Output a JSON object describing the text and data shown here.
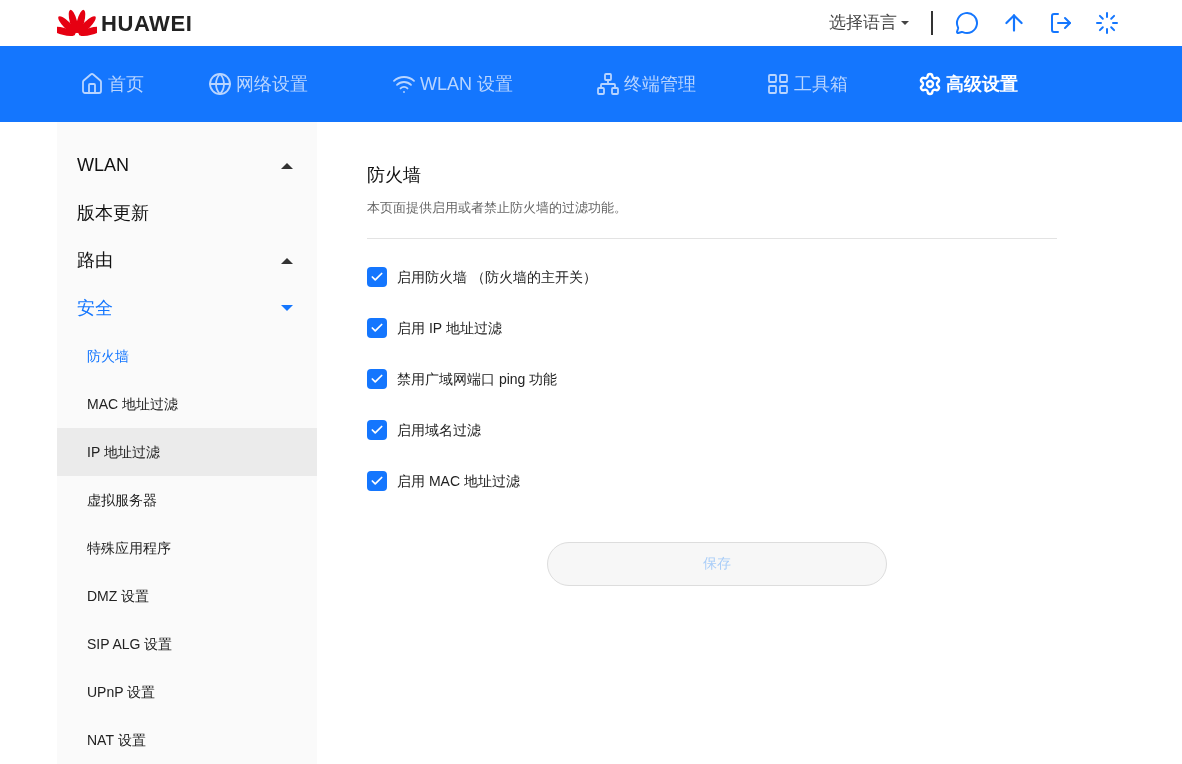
{
  "header": {
    "brand": "HUAWEI",
    "language": "选择语言"
  },
  "nav": [
    {
      "label": "首页",
      "selected": false
    },
    {
      "label": "网络设置",
      "selected": false
    },
    {
      "label": "WLAN 设置",
      "selected": false
    },
    {
      "label": "终端管理",
      "selected": false
    },
    {
      "label": "工具箱",
      "selected": false
    },
    {
      "label": "高级设置",
      "selected": true
    }
  ],
  "sidebar": {
    "items": [
      {
        "label": "WLAN",
        "kind": "group",
        "expanded": false,
        "selected": false
      },
      {
        "label": "版本更新",
        "kind": "link",
        "selected": false
      },
      {
        "label": "路由",
        "kind": "group",
        "expanded": false,
        "selected": false
      },
      {
        "label": "安全",
        "kind": "group",
        "expanded": true,
        "selected": true,
        "children": [
          {
            "label": "防火墙",
            "selected": true,
            "hovered": false
          },
          {
            "label": "MAC 地址过滤",
            "selected": false,
            "hovered": false
          },
          {
            "label": "IP 地址过滤",
            "selected": false,
            "hovered": true
          },
          {
            "label": "虚拟服务器",
            "selected": false,
            "hovered": false
          },
          {
            "label": "特殊应用程序",
            "selected": false,
            "hovered": false
          },
          {
            "label": "DMZ 设置",
            "selected": false,
            "hovered": false
          },
          {
            "label": "SIP ALG 设置",
            "selected": false,
            "hovered": false
          },
          {
            "label": "UPnP 设置",
            "selected": false,
            "hovered": false
          },
          {
            "label": "NAT 设置",
            "selected": false,
            "hovered": false
          }
        ]
      }
    ]
  },
  "content": {
    "title": "防火墙",
    "description": "本页面提供启用或者禁止防火墙的过滤功能。",
    "options": [
      {
        "label": "启用防火墙 （防火墙的主开关）",
        "checked": true
      },
      {
        "label": "启用 IP 地址过滤",
        "checked": true
      },
      {
        "label": "禁用广域网端口 ping 功能",
        "checked": true
      },
      {
        "label": "启用域名过滤",
        "checked": true
      },
      {
        "label": "启用 MAC 地址过滤",
        "checked": true
      }
    ],
    "save_button": {
      "label": "保存",
      "disabled": true
    }
  }
}
